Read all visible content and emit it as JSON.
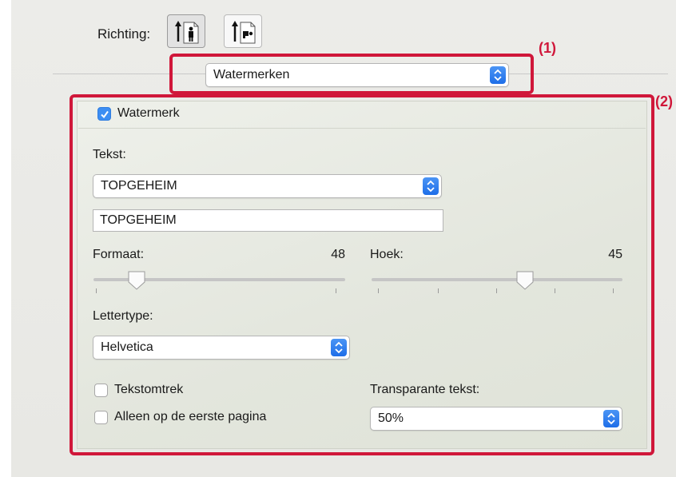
{
  "orientation": {
    "label": "Richting:",
    "options": [
      "portrait-icon",
      "landscape-icon"
    ],
    "selected": "portrait"
  },
  "panel_selector": {
    "value": "Watermerken"
  },
  "callouts": {
    "one": "(1)",
    "two": "(2)"
  },
  "watermark": {
    "enabled_label": "Watermerk",
    "enabled": true,
    "text_label": "Tekst:",
    "text_preset": "TOPGEHEIM",
    "text_value": "TOPGEHEIM",
    "size_label": "Formaat:",
    "size_value": "48",
    "size_fraction": 0.17,
    "angle_label": "Hoek:",
    "angle_value": "45",
    "angle_fraction": 0.61,
    "font_label": "Lettertype:",
    "font_value": "Helvetica",
    "outline_label": "Tekstomtrek",
    "outline_checked": false,
    "first_page_label": "Alleen op de eerste pagina",
    "first_page_checked": false,
    "transparency_label": "Transparante tekst:",
    "transparency_value": "50%"
  },
  "colors": {
    "accent": "#3d8ef2",
    "highlight": "#d0173a"
  }
}
